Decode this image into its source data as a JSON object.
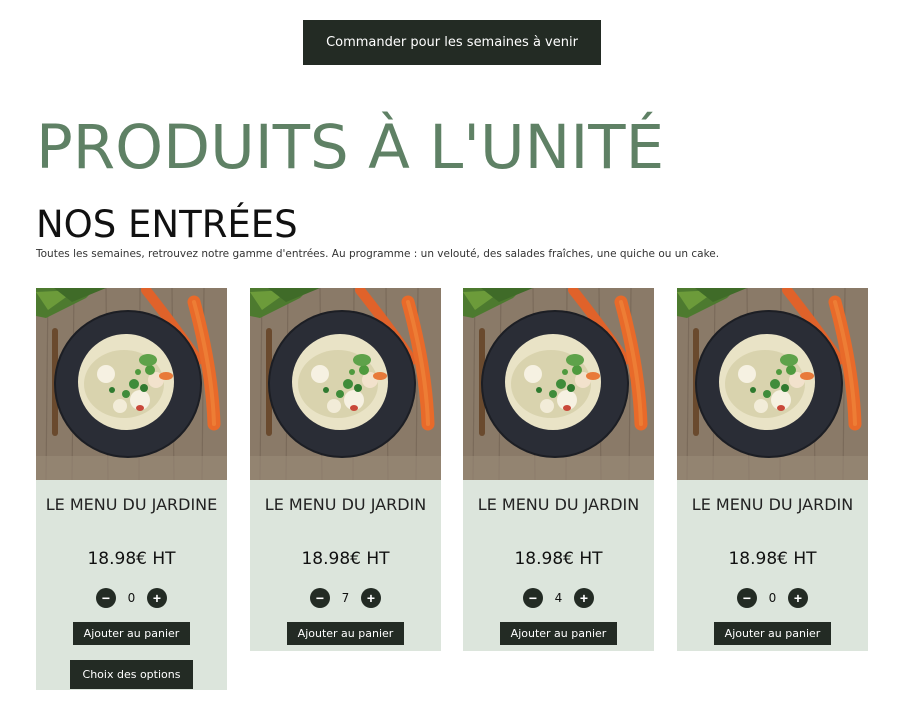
{
  "top_button": {
    "label": "Commander pour les semaines à venir"
  },
  "page_title": "PRODUITS À L'UNITÉ",
  "section": {
    "title": "NOS ENTRÉES",
    "description": "Toutes les semaines, retrouvez notre gamme d'entrées. Au programme : un velouté, des salades fraîches, une quiche ou un cake."
  },
  "colors": {
    "accent_green": "#5f8165",
    "dark_button": "#232b24",
    "card_background": "#dce5dc"
  },
  "products": [
    {
      "name": "LE MENU DU JARDINE",
      "price": "18.98€ HT",
      "quantity": "0",
      "minus_icon": "minus-icon",
      "plus_icon": "plus-icon",
      "add_label": "Ajouter au panier",
      "options_label": "Choix des options"
    },
    {
      "name": "LE MENU DU JARDIN",
      "price": "18.98€ HT",
      "quantity": "7",
      "minus_icon": "minus-icon",
      "plus_icon": "plus-icon",
      "add_label": "Ajouter au panier"
    },
    {
      "name": "LE MENU DU JARDIN",
      "price": "18.98€ HT",
      "quantity": "4",
      "minus_icon": "minus-icon",
      "plus_icon": "plus-icon",
      "add_label": "Ajouter au panier"
    },
    {
      "name": "LE MENU DU JARDIN",
      "price": "18.98€ HT",
      "quantity": "0",
      "minus_icon": "minus-icon",
      "plus_icon": "plus-icon",
      "add_label": "Ajouter au panier"
    }
  ]
}
